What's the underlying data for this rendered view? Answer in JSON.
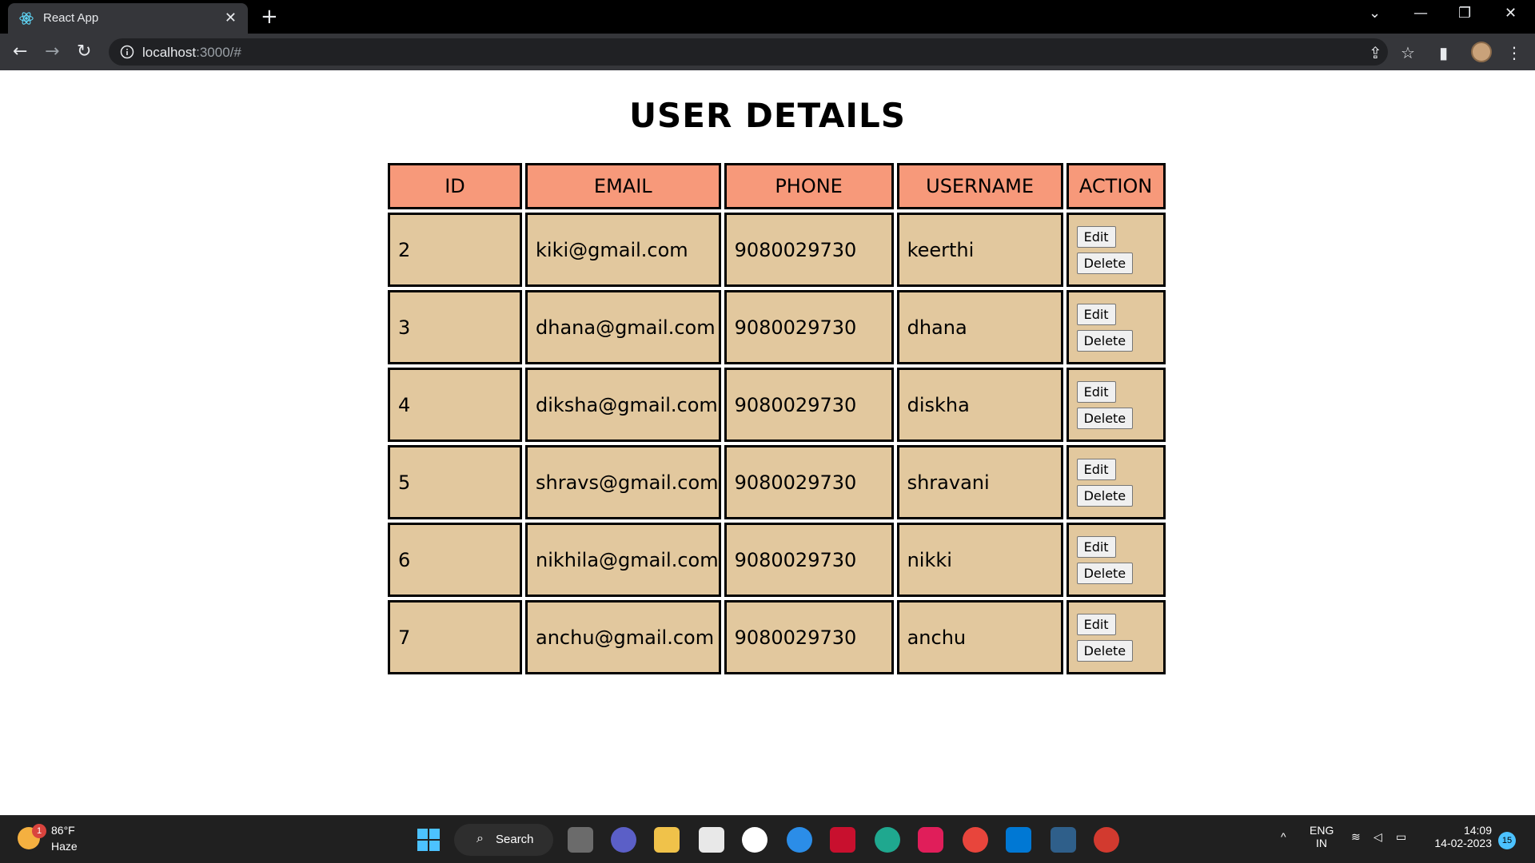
{
  "browser": {
    "tab_title": "React App",
    "url_host": "localhost",
    "url_rest": ":3000/#"
  },
  "page": {
    "title": "USER DETAILS",
    "columns": [
      "ID",
      "EMAIL",
      "PHONE",
      "USERNAME",
      "ACTION"
    ],
    "rows": [
      {
        "id": "2",
        "email": "kiki@gmail.com",
        "phone": "9080029730",
        "username": "keerthi"
      },
      {
        "id": "3",
        "email": "dhana@gmail.com",
        "phone": "9080029730",
        "username": "dhana"
      },
      {
        "id": "4",
        "email": "diksha@gmail.com",
        "phone": "9080029730",
        "username": "diskha"
      },
      {
        "id": "5",
        "email": "shravs@gmail.com",
        "phone": "9080029730",
        "username": "shravani"
      },
      {
        "id": "6",
        "email": "nikhila@gmail.com",
        "phone": "9080029730",
        "username": "nikki"
      },
      {
        "id": "7",
        "email": "anchu@gmail.com",
        "phone": "9080029730",
        "username": "anchu"
      }
    ],
    "edit_label": "Edit",
    "delete_label": "Delete"
  },
  "taskbar": {
    "weather_badge": "1",
    "temperature": "86°F",
    "condition": "Haze",
    "search_label": "Search",
    "lang_line1": "ENG",
    "lang_line2": "IN",
    "time": "14:09",
    "date": "14-02-2023",
    "notification_count": "15"
  },
  "colors": {
    "header_bg": "#f7997a",
    "cell_bg": "#e2c89e"
  }
}
